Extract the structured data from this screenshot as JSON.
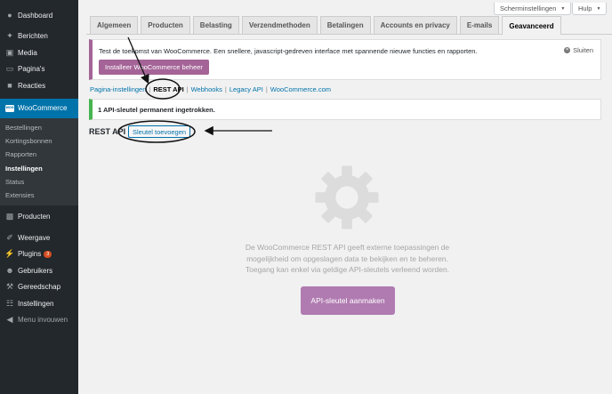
{
  "sidebar": {
    "top": [
      {
        "label": "Dashboard",
        "icon": "dashboard-icon"
      },
      {
        "label": "Berichten",
        "icon": "pin-icon"
      },
      {
        "label": "Media",
        "icon": "media-icon"
      },
      {
        "label": "Pagina's",
        "icon": "pages-icon"
      },
      {
        "label": "Reacties",
        "icon": "comments-icon"
      }
    ],
    "woocommerce": {
      "label": "WooCommerce",
      "icon_text": "woo"
    },
    "submenu": [
      "Bestellingen",
      "Kortingsbonnen",
      "Rapporten",
      "Instellingen",
      "Status",
      "Extensies"
    ],
    "bottom": [
      {
        "label": "Producten",
        "icon": "products-icon"
      },
      {
        "label": "Weergave",
        "icon": "brush-icon"
      },
      {
        "label": "Plugins",
        "icon": "plugins-icon",
        "badge": "3"
      },
      {
        "label": "Gebruikers",
        "icon": "users-icon"
      },
      {
        "label": "Gereedschap",
        "icon": "tools-icon"
      },
      {
        "label": "Instellingen",
        "icon": "settings-icon"
      },
      {
        "label": "Menu invouwen",
        "icon": "collapse-icon"
      }
    ]
  },
  "screen_meta": {
    "screen_options": "Scherminstellingen",
    "help": "Hulp"
  },
  "tabs": [
    "Algemeen",
    "Producten",
    "Belasting",
    "Verzendmethoden",
    "Betalingen",
    "Accounts en privacy",
    "E-mails",
    "Geavanceerd"
  ],
  "notice": {
    "text": "Test de toekomst van WooCommerce. Een snellere, javascript-gedreven interface met spannende nieuwe functies en rapporten.",
    "button": "Installeer WooCommerce beheer",
    "dismiss": "Sluiten"
  },
  "subsub": {
    "page_settings": "Pagina-instellingen",
    "rest_api": "REST API",
    "webhooks": "Webhooks",
    "legacy_api": "Legacy API",
    "woocommerce_com": "WooCommerce.com"
  },
  "success_message": "1 API-sleutel permanent ingetrokken.",
  "heading": "REST API",
  "add_key_button": "Sleutel toevoegen",
  "blank_state": {
    "message": "De WooCommerce REST API geeft externe toepassingen de mogelijkheid om opgeslagen data te bekijken en te beheren. Toegang kan enkel via geldige API-sleutels verleend worden.",
    "button": "API-sleutel aanmaken"
  },
  "colors": {
    "sidebar_bg": "#23282d",
    "active_blue": "#0073aa",
    "woo_purple": "#a46497",
    "success_green": "#46b450"
  }
}
